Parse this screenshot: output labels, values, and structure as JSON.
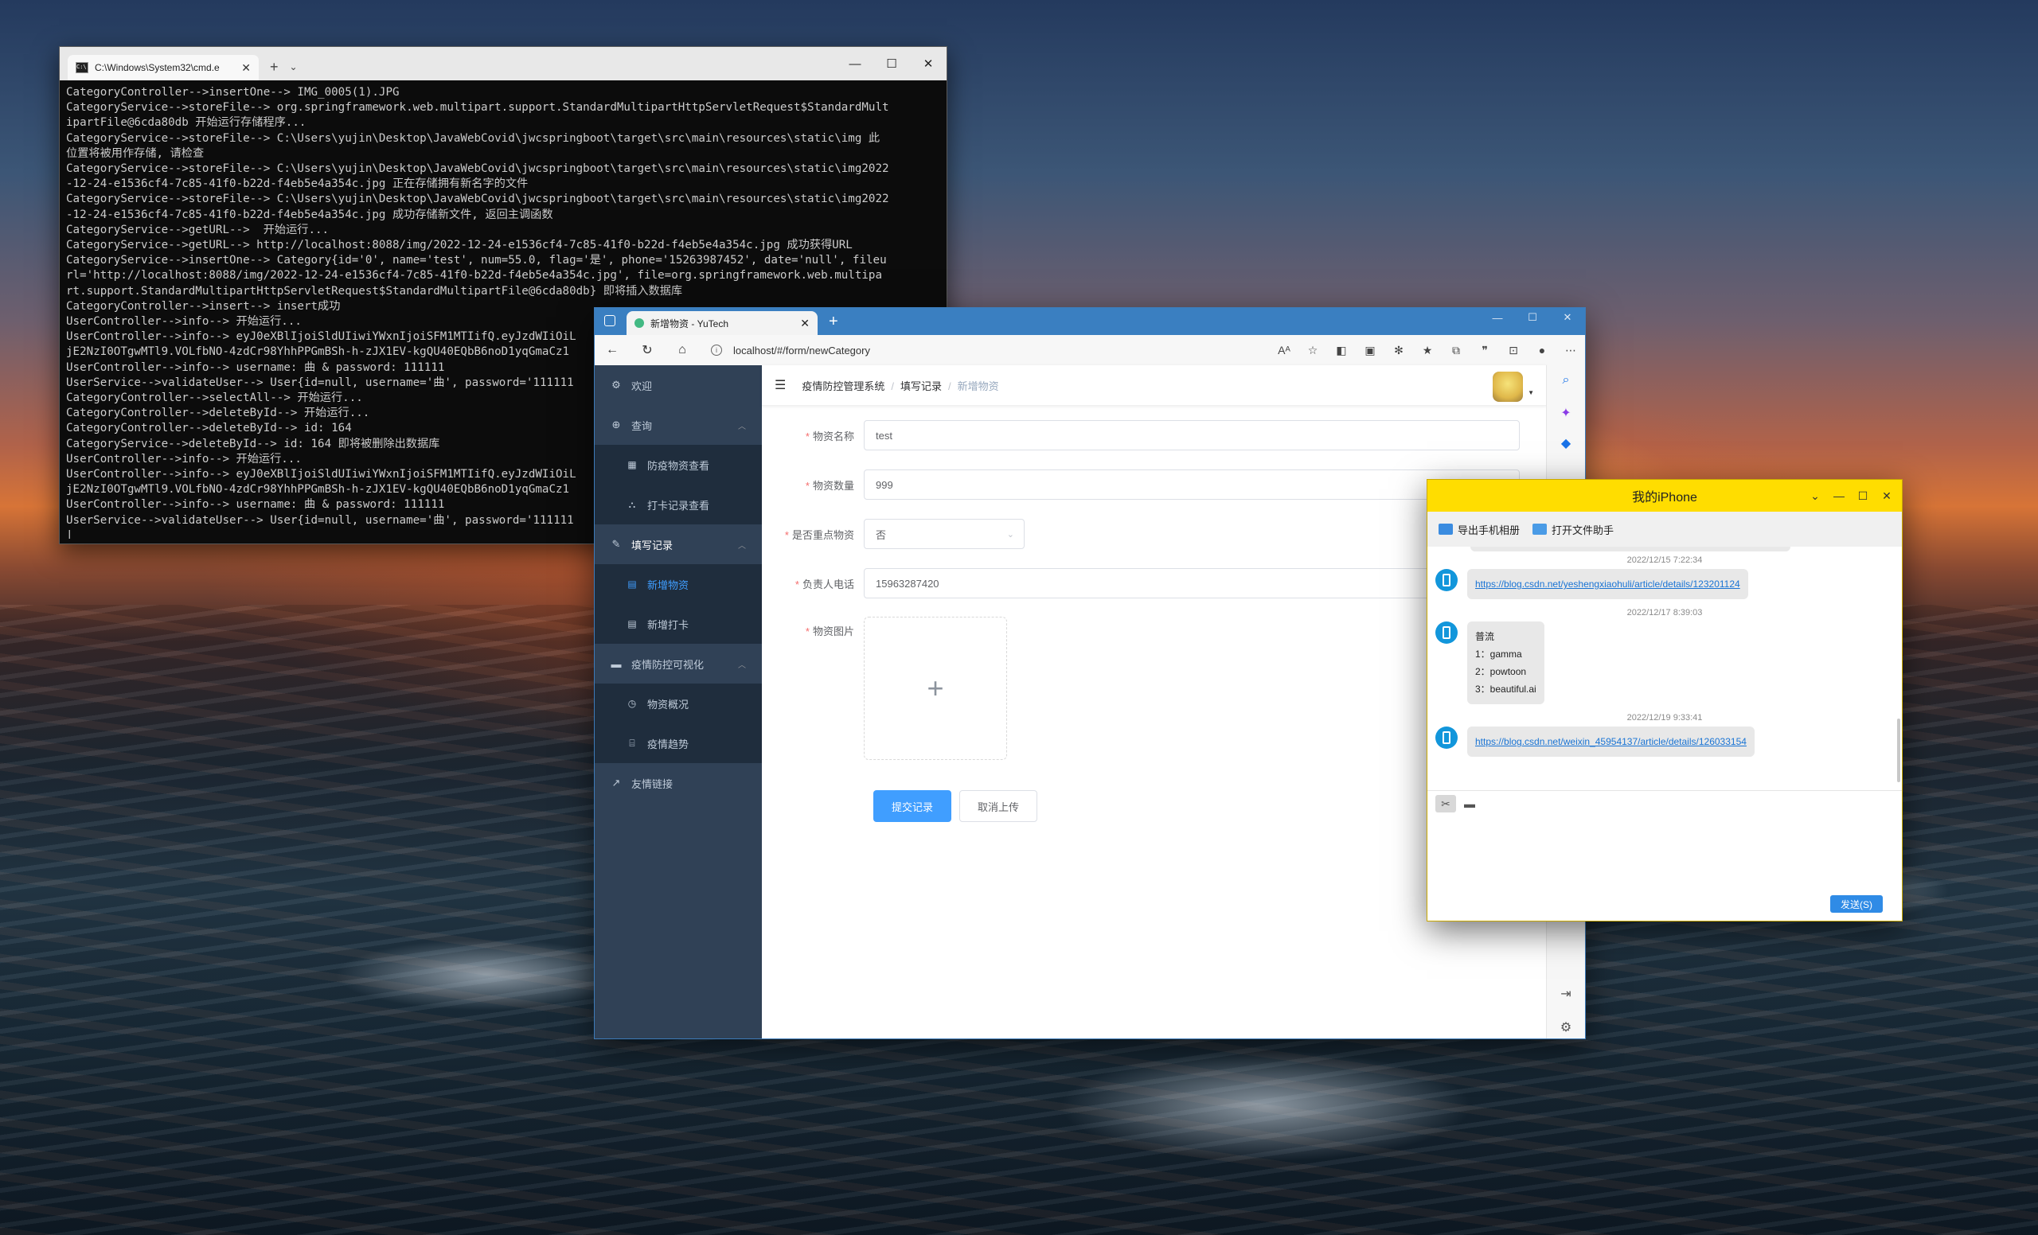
{
  "cmd": {
    "tab_title": "C:\\Windows\\System32\\cmd.e",
    "lines": [
      "CategoryController-->insertOne--> IMG_0005(1).JPG",
      "CategoryService-->storeFile--> org.springframework.web.multipart.support.StandardMultipartHttpServletRequest$StandardMult",
      "ipartFile@6cda80db 开始运行存储程序...",
      "CategoryService-->storeFile--> C:\\Users\\yujin\\Desktop\\JavaWebCovid\\jwcspringboot\\target\\src\\main\\resources\\static\\img 此",
      "位置将被用作存储, 请检查",
      "CategoryService-->storeFile--> C:\\Users\\yujin\\Desktop\\JavaWebCovid\\jwcspringboot\\target\\src\\main\\resources\\static\\img2022",
      "-12-24-e1536cf4-7c85-41f0-b22d-f4eb5e4a354c.jpg 正在存储拥有新名字的文件",
      "CategoryService-->storeFile--> C:\\Users\\yujin\\Desktop\\JavaWebCovid\\jwcspringboot\\target\\src\\main\\resources\\static\\img2022",
      "-12-24-e1536cf4-7c85-41f0-b22d-f4eb5e4a354c.jpg 成功存储新文件, 返回主调函数",
      "CategoryService-->getURL-->  开始运行...",
      "CategoryService-->getURL--> http://localhost:8088/img/2022-12-24-e1536cf4-7c85-41f0-b22d-f4eb5e4a354c.jpg 成功获得URL",
      "CategoryService-->insertOne--> Category{id='0', name='test', num=55.0, flag='是', phone='15263987452', date='null', fileu",
      "rl='http://localhost:8088/img/2022-12-24-e1536cf4-7c85-41f0-b22d-f4eb5e4a354c.jpg', file=org.springframework.web.multipa",
      "rt.support.StandardMultipartHttpServletRequest$StandardMultipartFile@6cda80db} 即将插入数据库",
      "CategoryController-->insert--> insert成功",
      "UserController-->info--> 开始运行...",
      "UserController-->info--> eyJ0eXBlIjoiSldUIiwiYWxnIjoiSFM1MTIifQ.eyJzdWIiOiL",
      "jE2NzI0OTgwMTl9.VOLfbNO-4zdCr98YhhPPGmBSh-h-zJX1EV-kgQU40EQbB6noD1yqGmaCz1",
      "UserController-->info--> username: 曲 & password: 111111",
      "UserService-->validateUser--> User{id=null, username='曲', password='111111",
      "CategoryController-->selectAll--> 开始运行...",
      "CategoryController-->deleteById--> 开始运行...",
      "CategoryController-->deleteById--> id: 164",
      "CategoryService-->deleteById--> id: 164 即将被删除出数据库",
      "UserController-->info--> 开始运行...",
      "UserController-->info--> eyJ0eXBlIjoiSldUIiwiYWxnIjoiSFM1MTIifQ.eyJzdWIiOiL",
      "jE2NzI0OTgwMTl9.VOLfbNO-4zdCr98YhhPPGmBSh-h-zJX1EV-kgQU40EQbB6noD1yqGmaCz1",
      "UserController-->info--> username: 曲 & password: 111111",
      "UserService-->validateUser--> User{id=null, username='曲', password='111111"
    ]
  },
  "browser": {
    "tab_title": "新增物资 - YuTech",
    "url": "localhost/#/form/newCategory",
    "sidebar": {
      "welcome": "欢迎",
      "query": "查询",
      "query_items": [
        "防疫物资查看",
        "打卡记录查看"
      ],
      "write": "填写记录",
      "write_items": [
        "新增物资",
        "新增打卡"
      ],
      "visual": "疫情防控可视化",
      "visual_items": [
        "物资概况",
        "疫情趋势"
      ],
      "links": "友情链接"
    },
    "breadcrumb": [
      "疫情防控管理系统",
      "填写记录",
      "新增物资"
    ],
    "form": {
      "name_label": "物资名称",
      "name_value": "test",
      "qty_label": "物资数量",
      "qty_value": "999",
      "key_label": "是否重点物资",
      "key_value": "否",
      "phone_label": "负责人电话",
      "phone_value": "15963287420",
      "image_label": "物资图片",
      "submit": "提交记录",
      "cancel": "取消上传"
    }
  },
  "chat": {
    "title": "我的iPhone",
    "export_photos": "导出手机相册",
    "open_assistant": "打开文件助手",
    "messages": [
      {
        "time": "2022/12/15 7:22:34",
        "link": "https://blog.csdn.net/yeshengxiaohuli/article/details/123201124"
      },
      {
        "time": "2022/12/17 8:39:03",
        "lines": [
          "普流",
          "1：gamma",
          "2：powtoon",
          "3：beautiful.ai"
        ]
      },
      {
        "time": "2022/12/19 9:33:41",
        "link": "https://blog.csdn.net/weixin_45954137/article/details/126033154"
      }
    ],
    "send": "发送(S)"
  },
  "colors": {
    "chat_title": "#ffdd00",
    "sidebar": "#304156",
    "primary": "#409eff",
    "browser_frame": "#3a7fc1"
  }
}
